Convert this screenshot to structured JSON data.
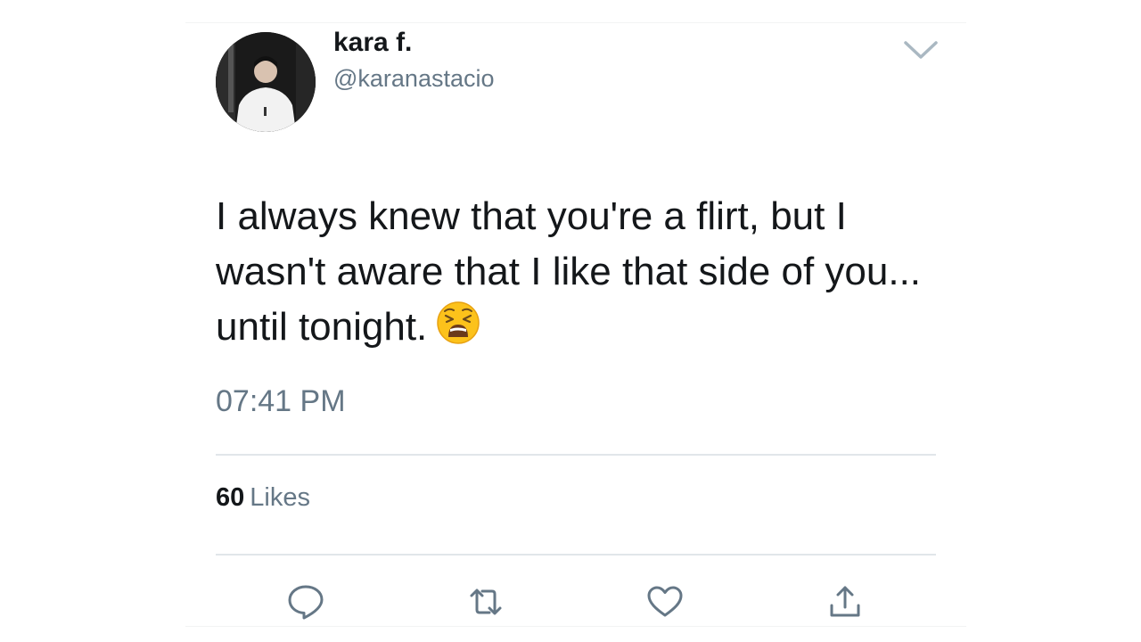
{
  "tweet": {
    "user": {
      "display_name": "kara f.",
      "handle": "@karanastacio",
      "avatar_icon": "profile-photo"
    },
    "text": "I always knew that you're a flirt, but I wasn't aware that I like that side of you... until tonight.",
    "emoji": "weary-face",
    "timestamp": "07:41 PM",
    "likes": {
      "count": "60",
      "label": "Likes"
    },
    "menu_icon": "chevron-down-icon",
    "actions": [
      {
        "name": "reply",
        "icon": "reply-icon"
      },
      {
        "name": "retweet",
        "icon": "retweet-icon"
      },
      {
        "name": "like",
        "icon": "heart-icon"
      },
      {
        "name": "share",
        "icon": "share-icon"
      }
    ]
  },
  "colors": {
    "text_primary": "#14171a",
    "text_secondary": "#657786",
    "divider": "#e1e6ea",
    "icon": "#657786",
    "background": "#ffffff"
  }
}
